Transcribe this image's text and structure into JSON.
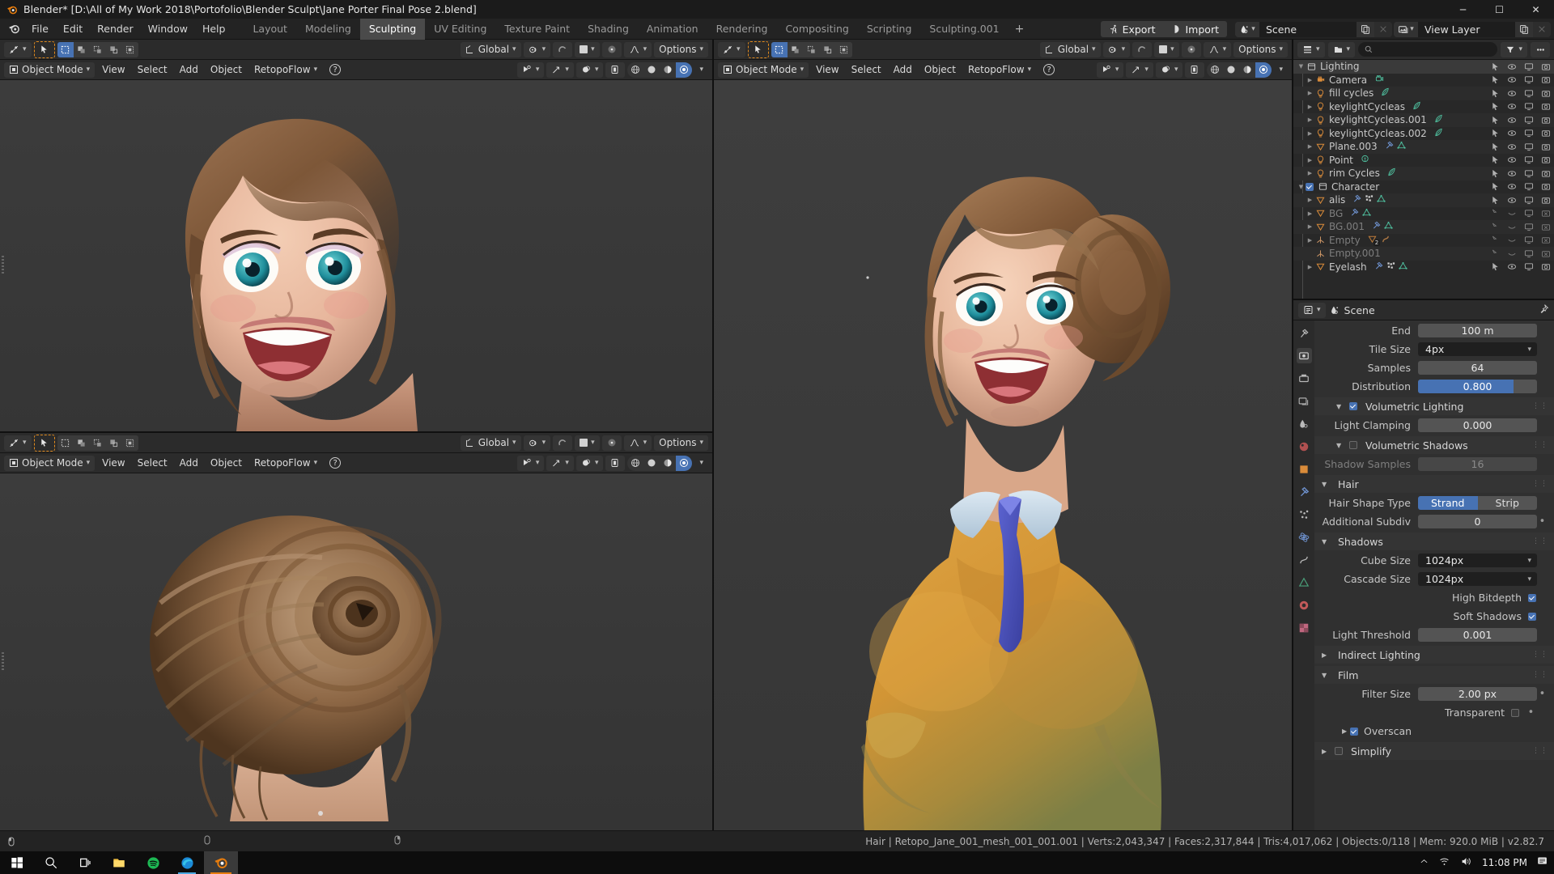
{
  "window": {
    "title": "Blender* [D:\\All of My Work 2018\\Portofolio\\Blender Sculpt\\Jane Porter Final Pose 2.blend]",
    "minimize": "─",
    "maximize": "☐",
    "close": "✕"
  },
  "topbar": {
    "menus": [
      "File",
      "Edit",
      "Render",
      "Window",
      "Help"
    ],
    "workspaces": [
      {
        "label": "Layout",
        "active": false
      },
      {
        "label": "Modeling",
        "active": false
      },
      {
        "label": "Sculpting",
        "active": true
      },
      {
        "label": "UV Editing",
        "active": false
      },
      {
        "label": "Texture Paint",
        "active": false
      },
      {
        "label": "Shading",
        "active": false
      },
      {
        "label": "Animation",
        "active": false
      },
      {
        "label": "Rendering",
        "active": false
      },
      {
        "label": "Compositing",
        "active": false
      },
      {
        "label": "Scripting",
        "active": false
      },
      {
        "label": "Sculpting.001",
        "active": false
      }
    ],
    "add_workspace": "+",
    "export_label": "Export",
    "import_label": "Import",
    "scene_name": "Scene",
    "view_layer_name": "View Layer"
  },
  "viewport_headers": {
    "transform_orientation": "Global",
    "mode": "Object Mode",
    "menus": [
      "View",
      "Select",
      "Add",
      "Object"
    ],
    "retopoflow": "RetopoFlow",
    "help": "?",
    "options": "Options"
  },
  "outliner": {
    "rows": [
      {
        "label": "Lighting",
        "icon": "collection-icon",
        "indent": 1,
        "tri": "▼",
        "dim": false,
        "check": null,
        "extras": [],
        "camera_on": true,
        "selected": true
      },
      {
        "label": "Camera",
        "icon": "camera-icon",
        "indent": 2,
        "tri": "▶",
        "dim": false,
        "check": null,
        "extras": [
          "camera-data-icon"
        ],
        "camera_on": true
      },
      {
        "label": "fill cycles",
        "icon": "light-icon",
        "indent": 2,
        "tri": "▶",
        "dim": false,
        "check": null,
        "extras": [
          "light-data-icon"
        ],
        "camera_on": true
      },
      {
        "label": "keylightCycleas",
        "icon": "light-icon",
        "indent": 2,
        "tri": "▶",
        "dim": false,
        "check": null,
        "extras": [
          "light-data-icon"
        ],
        "camera_on": true
      },
      {
        "label": "keylightCycleas.001",
        "icon": "light-icon",
        "indent": 2,
        "tri": "▶",
        "dim": false,
        "check": null,
        "extras": [
          "light-data-icon"
        ],
        "camera_on": true
      },
      {
        "label": "keylightCycleas.002",
        "icon": "light-icon",
        "indent": 2,
        "tri": "▶",
        "dim": false,
        "check": null,
        "extras": [
          "light-data-icon"
        ],
        "camera_on": true
      },
      {
        "label": "Plane.003",
        "icon": "mesh-icon",
        "indent": 2,
        "tri": "▶",
        "dim": false,
        "check": null,
        "extras": [
          "modifier-icon",
          "mesh-data-icon"
        ],
        "camera_on": true
      },
      {
        "label": "Point",
        "icon": "light-icon",
        "indent": 2,
        "tri": "▶",
        "dim": false,
        "check": null,
        "extras": [
          "point-light-data-icon"
        ],
        "camera_on": true
      },
      {
        "label": "rim Cycles",
        "icon": "light-icon",
        "indent": 2,
        "tri": "▶",
        "dim": false,
        "check": null,
        "extras": [
          "light-data-icon"
        ],
        "camera_on": true
      },
      {
        "label": "Character",
        "icon": "collection-icon",
        "indent": 1,
        "tri": "▼",
        "dim": false,
        "check": true,
        "extras": [],
        "camera_on": true
      },
      {
        "label": "alis",
        "icon": "mesh-icon",
        "indent": 2,
        "tri": "▶",
        "dim": false,
        "check": null,
        "extras": [
          "modifier-icon",
          "particles-icon",
          "mesh-data-icon"
        ],
        "camera_on": true
      },
      {
        "label": "BG",
        "icon": "mesh-icon",
        "indent": 2,
        "tri": "▶",
        "dim": true,
        "check": null,
        "extras": [
          "modifier-icon",
          "mesh-data-icon"
        ],
        "camera_on": false
      },
      {
        "label": "BG.001",
        "icon": "mesh-icon",
        "indent": 2,
        "tri": "▶",
        "dim": true,
        "check": null,
        "extras": [
          "modifier-icon",
          "mesh-data-icon"
        ],
        "camera_on": false
      },
      {
        "label": "Empty",
        "icon": "empty-icon",
        "indent": 2,
        "tri": "▶",
        "dim": true,
        "check": null,
        "extras": [
          "mesh-badge-2",
          "constraint-icon"
        ],
        "camera_on": false
      },
      {
        "label": "Empty.001",
        "icon": "empty-icon",
        "indent": 2,
        "tri": "",
        "dim": true,
        "check": null,
        "extras": [],
        "camera_on": false
      },
      {
        "label": "Eyelash",
        "icon": "mesh-icon",
        "indent": 2,
        "tri": "▶",
        "dim": false,
        "check": null,
        "extras": [
          "modifier-icon",
          "particles-icon",
          "mesh-data-icon"
        ],
        "camera_on": true
      }
    ],
    "search_placeholder": ""
  },
  "properties": {
    "breadcrumb": "Scene",
    "rows": [
      {
        "kind": "field",
        "label": "End",
        "value": "100 m",
        "type": "number"
      },
      {
        "kind": "dropdown",
        "label": "Tile Size",
        "value": "4px"
      },
      {
        "kind": "field",
        "label": "Samples",
        "value": "64",
        "type": "number"
      },
      {
        "kind": "slider",
        "label": "Distribution",
        "value": "0.800",
        "fill_pct": 80
      }
    ],
    "sections": [
      {
        "title": "Volumetric Lighting",
        "checked": true,
        "open": true,
        "indent": true,
        "rows": [
          {
            "kind": "field",
            "label": "Light Clamping",
            "value": "0.000"
          }
        ]
      },
      {
        "title": "Volumetric Shadows",
        "checked": false,
        "open": true,
        "indent": true,
        "rows": [
          {
            "kind": "field",
            "label": "Shadow Samples",
            "value": "16",
            "dim": true
          }
        ]
      },
      {
        "title": "Hair",
        "open": true,
        "rows": [
          {
            "kind": "toggle",
            "label": "Hair Shape Type",
            "options": [
              "Strand",
              "Strip"
            ],
            "selected": "Strand"
          },
          {
            "kind": "field",
            "label": "Additional Subdiv",
            "value": "0",
            "dot": true
          }
        ]
      },
      {
        "title": "Shadows",
        "open": true,
        "rows": [
          {
            "kind": "dropdown",
            "label": "Cube Size",
            "value": "1024px"
          },
          {
            "kind": "dropdown",
            "label": "Cascade Size",
            "value": "1024px"
          },
          {
            "kind": "checkbox",
            "label": "High Bitdepth",
            "checked": true
          },
          {
            "kind": "checkbox",
            "label": "Soft Shadows",
            "checked": true
          },
          {
            "kind": "field",
            "label": "Light Threshold",
            "value": "0.001"
          }
        ]
      },
      {
        "title": "Indirect Lighting",
        "open": false,
        "rows": []
      },
      {
        "title": "Film",
        "open": true,
        "rows": [
          {
            "kind": "field",
            "label": "Filter Size",
            "value": "2.00 px",
            "dot": true
          },
          {
            "kind": "checkbox",
            "label": "Transparent",
            "checked": false,
            "dot": true
          },
          {
            "kind": "subcheck",
            "label": "Overscan",
            "checked": true
          }
        ]
      },
      {
        "title": "Simplify",
        "open": false,
        "checked": false,
        "rows": []
      }
    ]
  },
  "statusbar": {
    "text": "Hair | Retopo_Jane_001_mesh_001_001.001 | Verts:2,043,347 | Faces:2,317,844 | Tris:4,017,062 | Objects:0/118 | Mem: 920.0 MiB | v2.82.7"
  },
  "taskbar": {
    "items": [
      "start-icon",
      "search-icon",
      "task-view-icon",
      "file-explorer-icon",
      "spotify-icon",
      "edge-icon",
      "blender-icon"
    ],
    "clock": "11:08 PM",
    "tray": [
      "chevron-up-icon",
      "wifi-icon",
      "volume-icon"
    ],
    "notifications": "notification-icon"
  },
  "colors": {
    "accent_blue": "#4772b3",
    "orange": "#e08a1e",
    "panel_bg": "#303030",
    "header_bg": "#2b2b2b"
  }
}
